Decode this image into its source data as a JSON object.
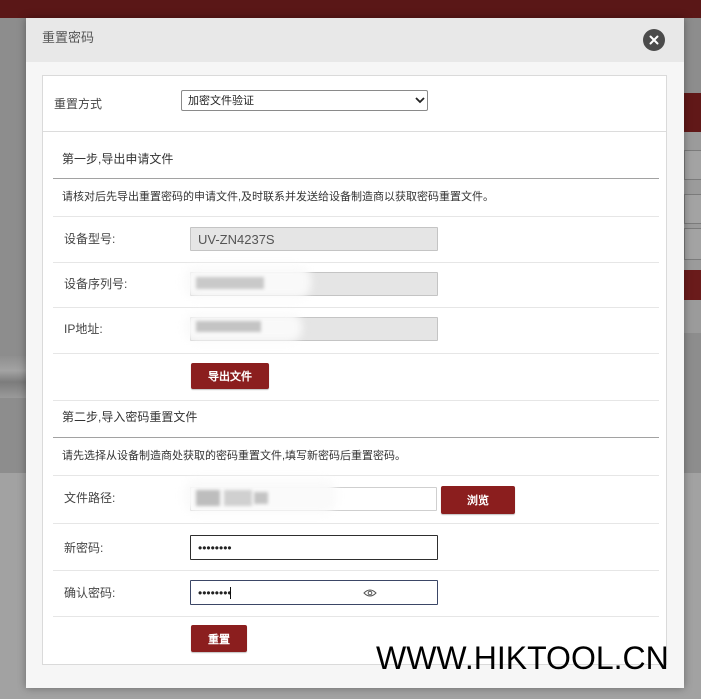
{
  "dialog": {
    "title": "重置密码"
  },
  "reset_method": {
    "label": "重置方式",
    "selected": "加密文件验证"
  },
  "step1": {
    "title": "第一步,导出申请文件",
    "description": "请核对后先导出重置密码的申请文件,及时联系并发送给设备制造商以获取密码重置文件。",
    "device_model": {
      "label": "设备型号:",
      "value": "UV-ZN4237S"
    },
    "serial_number": {
      "label": "设备序列号:"
    },
    "ip_address": {
      "label": "IP地址:"
    },
    "export_button": "导出文件"
  },
  "step2": {
    "title": "第二步,导入密码重置文件",
    "description": "请先选择从设备制造商处获取的密码重置文件,填写新密码后重置密码。",
    "file_path": {
      "label": "文件路径:"
    },
    "browse_button": "浏览",
    "new_password": {
      "label": "新密码:",
      "value": "••••••••"
    },
    "confirm_password": {
      "label": "确认密码:",
      "value": "••••••••"
    },
    "reset_button": "重置"
  },
  "watermark": "WWW.HIKTOOL.CN",
  "icons": {
    "close": "close-icon",
    "select_arrow": "chevron-down-icon",
    "show_password": "eye-icon"
  },
  "colors": {
    "accent": "#8b1e1e",
    "header_strip": "#5a1717",
    "overlay": "#8d8d8d"
  }
}
